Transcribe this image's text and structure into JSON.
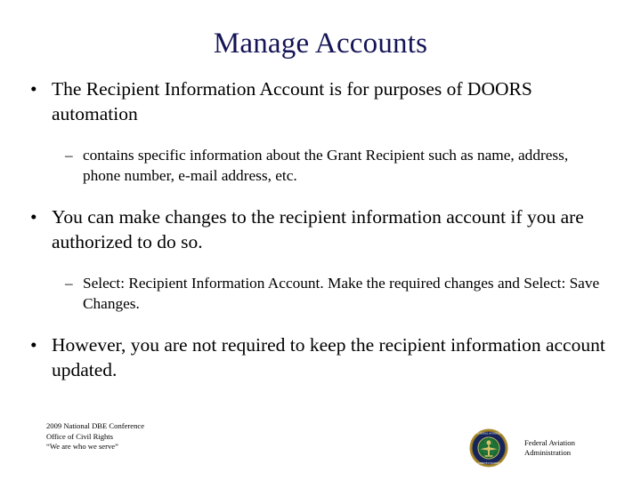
{
  "slide": {
    "title": "Manage Accounts",
    "background_color": "#FFFFFF",
    "title_color": "#141456",
    "body_color": "#000000",
    "bullet_marker": "•",
    "subbullet_marker": "–",
    "content": [
      {
        "level": 1,
        "text": "The Recipient Information Account is for purposes of DOORS automation"
      },
      {
        "level": 2,
        "text": "contains specific information about the Grant Recipient such as name, address, phone number, e-mail address, etc."
      },
      {
        "level": 1,
        "text": "You can make changes to the recipient information account if you are authorized to do so."
      },
      {
        "level": 2,
        "text": "Select:  Recipient Information Account.  Make the required changes and Select:  Save Changes."
      },
      {
        "level": 1,
        "text": "However, you are not required to keep the recipient information account updated."
      }
    ]
  },
  "footer": {
    "left_lines": [
      "2009 National DBE Conference",
      "Office of Civil Rights",
      "“We are who we serve”"
    ],
    "agency_name_line1": "Federal  Aviation",
    "agency_name_line2": "Administration",
    "seal": {
      "name": "faa-seal",
      "ring_text_top": "FEDERAL  AVIATION",
      "ring_text_bottom": "ADMINISTRATION",
      "rim_color": "#A98B2E",
      "ring_color": "#16245C",
      "center_color": "#1B6B32",
      "emblem_color": "#D8C06A"
    }
  }
}
